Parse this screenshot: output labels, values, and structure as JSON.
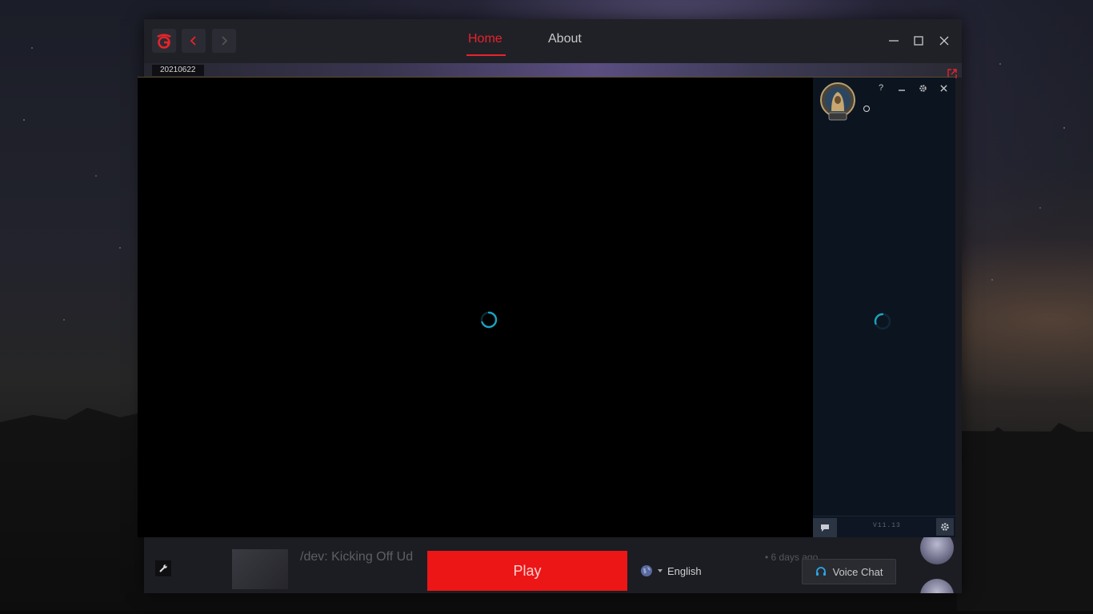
{
  "launcher": {
    "tabs": [
      {
        "label": "Home",
        "active": true
      },
      {
        "label": "About",
        "active": false
      }
    ],
    "version_tag": "20210622",
    "accent_color": "#e8232b",
    "news": {
      "title": "/dev: Kicking Off Ud",
      "time": "• 6 days ago"
    },
    "play_label": "Play",
    "language": "English",
    "voice_chat_label": "Voice Chat"
  },
  "friends_panel": {
    "help_label": "?",
    "client_version": "V11.13"
  },
  "icons": {
    "logo": "garena-logo-icon",
    "back": "chevron-left-icon",
    "forward": "chevron-right-icon",
    "minimize": "minimize-icon",
    "maximize": "maximize-icon",
    "close": "close-icon",
    "external": "external-link-icon",
    "tool": "wrench-icon",
    "globe": "globe-icon",
    "headset": "headset-icon",
    "chat": "chat-bubble-icon",
    "settings": "gear-icon"
  }
}
